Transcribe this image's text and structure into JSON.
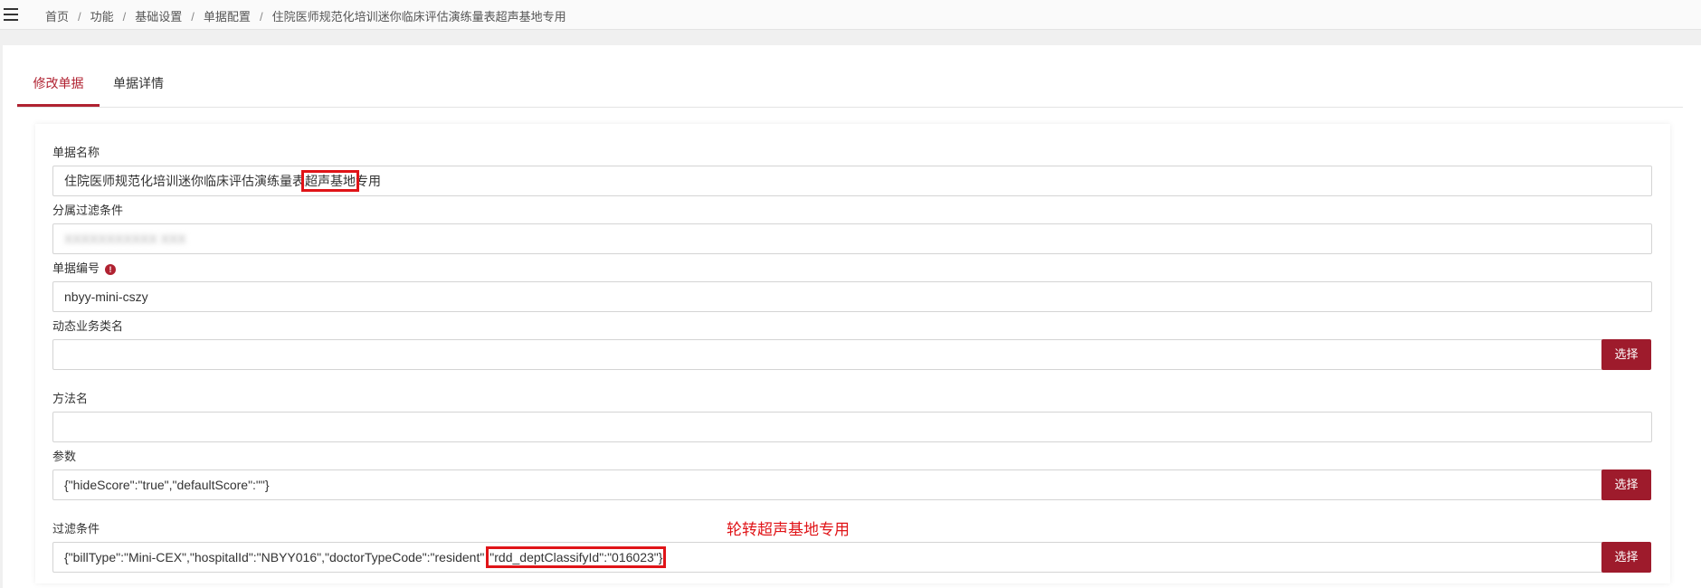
{
  "breadcrumb": [
    "首页",
    "功能",
    "基础设置",
    "单据配置",
    "住院医师规范化培训迷你临床评估演练量表超声基地专用"
  ],
  "tabs": [
    {
      "label": "修改单据",
      "active": true
    },
    {
      "label": "单据详情",
      "active": false
    }
  ],
  "form": {
    "bill_name": {
      "label": "单据名称",
      "value_before": "住院医师规范化培训迷你临床评估演练量表",
      "value_highlight": "超声基地",
      "value_after": "专用"
    },
    "filter_branch": {
      "label": "分属过滤条件",
      "value": "XXXXXXXXXXX XXX"
    },
    "bill_code": {
      "label": "单据编号",
      "value": "nbyy-mini-cszy"
    },
    "dynamic_class": {
      "label": "动态业务类名",
      "value": ""
    },
    "method": {
      "label": "方法名",
      "value": ""
    },
    "params": {
      "label": "参数",
      "value": "{\"hideScore\":\"true\",\"defaultScore\":\"\"}"
    },
    "filter": {
      "label": "过滤条件",
      "value_before": "{\"billType\":\"Mini-CEX\",\"hospitalId\":\"NBYY016\",\"doctorTypeCode\":\"resident\"",
      "value_highlight": "\"rdd_deptClassifyId\":\"016023\"}"
    }
  },
  "buttons": {
    "select_label": "选择"
  },
  "annotation": "轮转超声基地专用",
  "icons": {
    "menu": "hamburger-menu-icon",
    "info": "info-icon"
  },
  "colors": {
    "accent": "#b02231",
    "button": "#9e1b2c",
    "highlight": "#e01418"
  }
}
